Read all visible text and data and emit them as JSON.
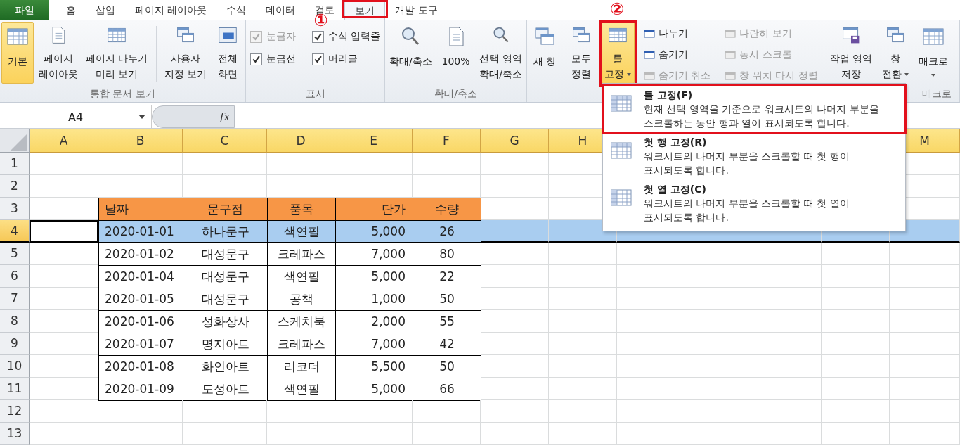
{
  "tabs": [
    {
      "label": "파일",
      "kind": "file",
      "selected": false,
      "outlined": false
    },
    {
      "label": "홈",
      "kind": "tab",
      "selected": false,
      "outlined": false
    },
    {
      "label": "삽입",
      "kind": "tab",
      "selected": false,
      "outlined": false
    },
    {
      "label": "페이지 레이아웃",
      "kind": "tab",
      "selected": false,
      "outlined": false
    },
    {
      "label": "수식",
      "kind": "tab",
      "selected": false,
      "outlined": false
    },
    {
      "label": "데이터",
      "kind": "tab",
      "selected": false,
      "outlined": false
    },
    {
      "label": "검토",
      "kind": "tab",
      "selected": false,
      "outlined": false
    },
    {
      "label": "보기",
      "kind": "tab",
      "selected": true,
      "outlined": true,
      "marker": "①"
    },
    {
      "label": "개발 도구",
      "kind": "tab",
      "selected": false,
      "outlined": false
    }
  ],
  "ribbon": {
    "groups": [
      {
        "label": "통합 문서 보기",
        "items": [
          {
            "kind": "large",
            "lines": [
              "기본"
            ],
            "selected": true
          },
          {
            "kind": "large",
            "lines": [
              "페이지",
              "레이아웃"
            ],
            "selected": false
          },
          {
            "kind": "large",
            "lines": [
              "페이지 나누기",
              "미리 보기"
            ],
            "selected": false
          },
          {
            "kind": "separator"
          },
          {
            "kind": "large",
            "lines": [
              "사용자",
              "지정 보기"
            ],
            "selected": false
          },
          {
            "kind": "large",
            "lines": [
              "전체",
              "화면"
            ],
            "selected": false
          }
        ]
      },
      {
        "label": "표시",
        "items": [
          {
            "kind": "stack",
            "items": [
              {
                "kind": "check",
                "label": "눈금자",
                "checked": true,
                "disabled": true
              },
              {
                "kind": "check",
                "label": "눈금선",
                "checked": true,
                "disabled": false
              }
            ]
          },
          {
            "kind": "stack",
            "items": [
              {
                "kind": "check",
                "label": "수식 입력줄",
                "checked": true,
                "disabled": false
              },
              {
                "kind": "check",
                "label": "머리글",
                "checked": true,
                "disabled": false
              }
            ]
          }
        ]
      },
      {
        "label": "확대/축소",
        "items": [
          {
            "kind": "large",
            "lines": [
              "확대/축소"
            ],
            "selected": false
          },
          {
            "kind": "large",
            "lines": [
              "100%"
            ],
            "selected": false
          },
          {
            "kind": "large",
            "lines": [
              "선택 영역",
              "확대/축소"
            ],
            "selected": false
          }
        ]
      },
      {
        "items": [
          {
            "kind": "large",
            "lines": [
              "새 창"
            ],
            "selected": false
          },
          {
            "kind": "large",
            "lines": [
              "모두",
              "정렬"
            ],
            "selected": false
          },
          {
            "kind": "large",
            "lines": [
              "틀",
              "고정"
            ],
            "selected": true,
            "dropdown": true,
            "outlined": true,
            "marker": "②"
          },
          {
            "kind": "stack",
            "items": [
              {
                "kind": "small",
                "label": "나누기",
                "disabled": false
              },
              {
                "kind": "small",
                "label": "숨기기",
                "disabled": false
              },
              {
                "kind": "small",
                "label": "숨기기 취소",
                "disabled": true
              }
            ]
          },
          {
            "kind": "stack",
            "items": [
              {
                "kind": "small",
                "label": "나란히 보기",
                "disabled": true
              },
              {
                "kind": "small",
                "label": "동시 스크롤",
                "disabled": true
              },
              {
                "kind": "small",
                "label": "창 위치 다시 정렬",
                "disabled": true
              }
            ]
          },
          {
            "kind": "large",
            "lines": [
              "작업 영역",
              "저장"
            ],
            "selected": false
          },
          {
            "kind": "large",
            "lines": [
              "창",
              "전환"
            ],
            "selected": false,
            "dropdown": true
          }
        ]
      },
      {
        "label": "매크로",
        "items": [
          {
            "kind": "large",
            "lines": [
              "매크로"
            ],
            "selected": false,
            "dropdown": true
          }
        ]
      }
    ]
  },
  "formula_bar": {
    "name_box": "A4",
    "function_label": "fx"
  },
  "menu": {
    "items": [
      {
        "title": "틀 고정(F)",
        "description": "현재 선택 영역을 기준으로 워크시트의 나머지 부분을\n스크롤하는 동안 행과 열이 표시되도록 합니다.",
        "outlined": true
      },
      {
        "title": "첫 행 고정(R)",
        "description": "워크시트의 나머지 부분을 스크롤할 때 첫 행이\n표시되도록 합니다.",
        "outlined": false
      },
      {
        "title": "첫 열 고정(C)",
        "description": "워크시트의 나머지 부분을 스크롤할 때 첫 열이\n표시되도록 합니다.",
        "outlined": false
      }
    ]
  },
  "sheet": {
    "columns": [
      "A",
      "B",
      "C",
      "D",
      "E",
      "F",
      "G",
      "H",
      "M"
    ],
    "rows": [
      {
        "label": "1",
        "selected": false
      },
      {
        "label": "2",
        "selected": false
      },
      {
        "label": "3",
        "selected": false
      },
      {
        "label": "4",
        "selected": true
      },
      {
        "label": "5",
        "selected": false
      },
      {
        "label": "6",
        "selected": false
      },
      {
        "label": "7",
        "selected": false
      },
      {
        "label": "8",
        "selected": false
      },
      {
        "label": "9",
        "selected": false
      },
      {
        "label": "10",
        "selected": false
      },
      {
        "label": "11",
        "selected": false
      },
      {
        "label": "12",
        "selected": false
      },
      {
        "label": "13",
        "selected": false
      }
    ]
  },
  "table": {
    "columns": [
      "날짜",
      "문구점",
      "품목",
      "단가",
      "수량"
    ],
    "rows": [
      [
        "2020-01-01",
        "하나문구",
        "색연필",
        "5,000",
        "26"
      ],
      [
        "2020-01-02",
        "대성문구",
        "크레파스",
        "7,000",
        "80"
      ],
      [
        "2020-01-04",
        "대성문구",
        "색연필",
        "5,000",
        "22"
      ],
      [
        "2020-01-05",
        "대성문구",
        "공책",
        "1,000",
        "50"
      ],
      [
        "2020-01-06",
        "성화상사",
        "스케치북",
        "2,000",
        "55"
      ],
      [
        "2020-01-07",
        "명지아트",
        "크레파스",
        "7,000",
        "42"
      ],
      [
        "2020-01-08",
        "화인아트",
        "리코더",
        "5,500",
        "50"
      ],
      [
        "2020-01-09",
        "도성아트",
        "색연필",
        "5,000",
        "66"
      ]
    ]
  }
}
